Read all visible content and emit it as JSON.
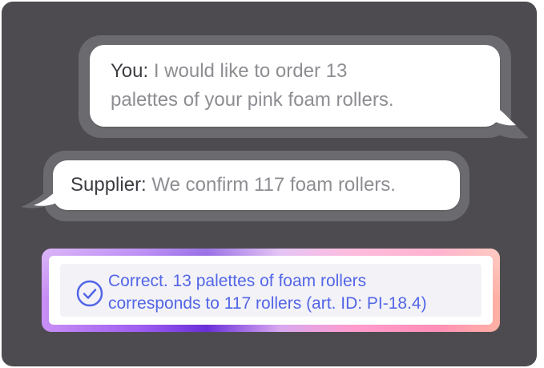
{
  "messages": [
    {
      "speaker": "You:",
      "lines": [
        " I would like to order 13",
        "palettes of your pink foam rollers."
      ]
    },
    {
      "speaker": "Supplier:",
      "lines": [
        " We confirm 117 foam rollers."
      ]
    }
  ],
  "result": {
    "lines": [
      "Correct. 13 palettes of foam rollers",
      "corresponds to 117 rollers (art. ID: PI-18.4)"
    ]
  },
  "colors": {
    "panel": "#4d4b50",
    "bubble": "#ffffff",
    "speaker_text": "#3d3c42",
    "message_text": "#8e8d92",
    "result_text": "#5266e6"
  },
  "icons": {
    "result": "check-circle-icon"
  }
}
